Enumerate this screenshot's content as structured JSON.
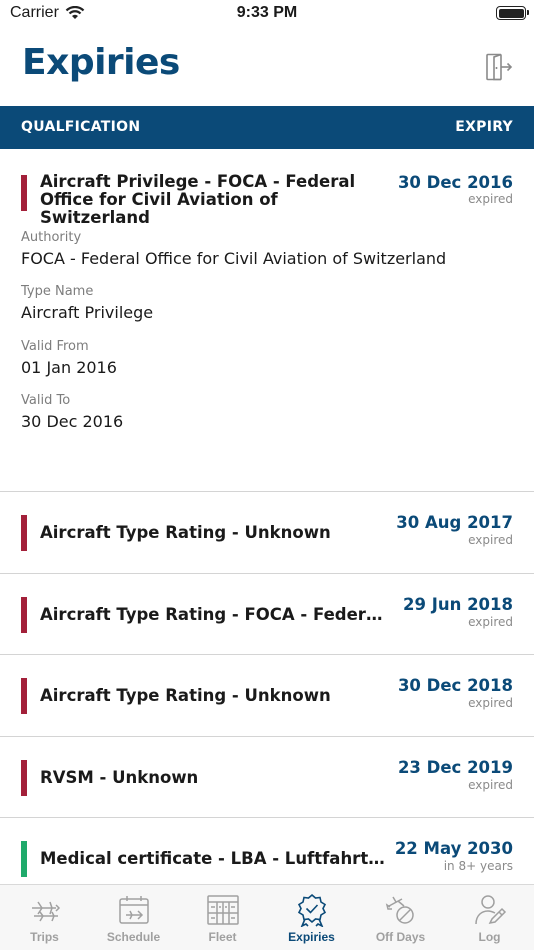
{
  "status_bar": {
    "carrier": "Carrier",
    "time": "9:33 PM"
  },
  "header": {
    "title": "Expiries"
  },
  "columns": {
    "left": "QUALFICATION",
    "right": "EXPIRY"
  },
  "expanded_item": {
    "title": "Aircraft Privilege - FOCA - Federal Office for Civil Aviation of Switzerland",
    "date": "30 Dec 2016",
    "status": "expired",
    "status_color": "#a3203a",
    "details": [
      {
        "label": "Authority",
        "value": "FOCA - Federal Office for Civil Aviation of Switzerland"
      },
      {
        "label": "Type Name",
        "value": "Aircraft Privilege"
      },
      {
        "label": "Valid From",
        "value": "01 Jan 2016"
      },
      {
        "label": "Valid To",
        "value": "30 Dec 2016"
      }
    ]
  },
  "items": [
    {
      "title": "Aircraft Type Rating - Unknown",
      "date": "30 Aug 2017",
      "status": "expired",
      "status_color": "#a3203a"
    },
    {
      "title": "Aircraft Type Rating - FOCA - Federal Office for Civil Aviation of Switzerland",
      "date": "29 Jun 2018",
      "status": "expired",
      "status_color": "#a3203a"
    },
    {
      "title": "Aircraft Type Rating - Unknown",
      "date": "30 Dec 2018",
      "status": "expired",
      "status_color": "#a3203a"
    },
    {
      "title": "RVSM - Unknown",
      "date": "23 Dec 2019",
      "status": "expired",
      "status_color": "#a3203a"
    },
    {
      "title": "Medical certificate - LBA - Luftfahrt-Bundesamt",
      "date": "22 May 2030",
      "status": "in 8+ years",
      "status_color": "#1faa6b"
    }
  ],
  "tabs": [
    {
      "label": "Trips",
      "icon": "trips-icon",
      "active": false
    },
    {
      "label": "Schedule",
      "icon": "schedule-icon",
      "active": false
    },
    {
      "label": "Fleet",
      "icon": "fleet-icon",
      "active": false
    },
    {
      "label": "Expiries",
      "icon": "expiries-icon",
      "active": true
    },
    {
      "label": "Off Days",
      "icon": "off-days-icon",
      "active": false
    },
    {
      "label": "Log",
      "icon": "log-icon",
      "active": false
    }
  ],
  "colors": {
    "brand": "#0b4a78",
    "expired": "#a3203a",
    "valid": "#1faa6b"
  }
}
